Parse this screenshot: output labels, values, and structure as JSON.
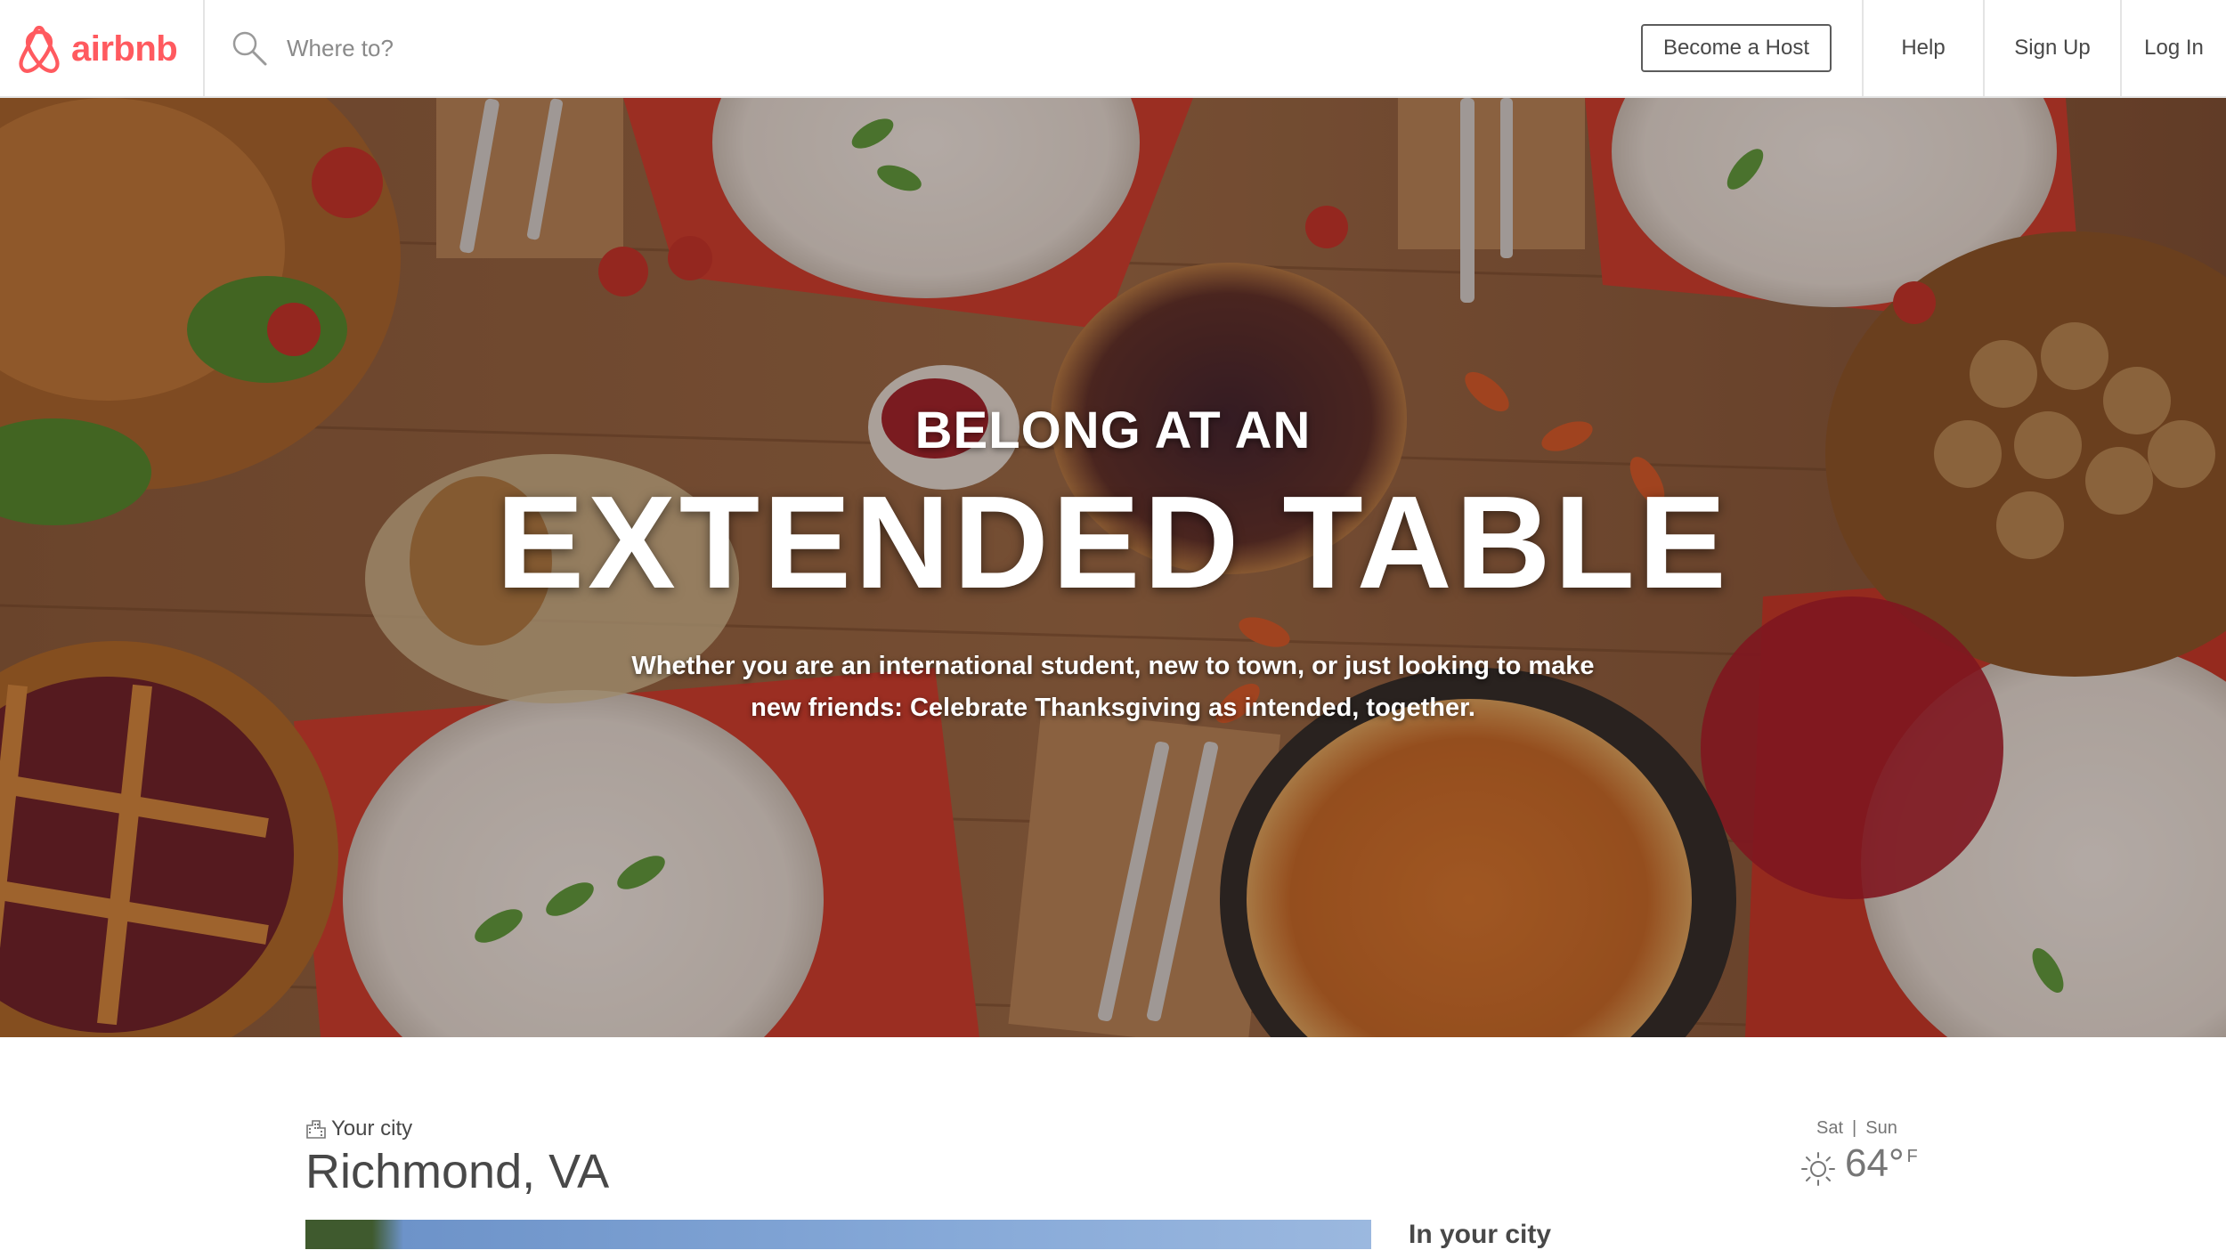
{
  "brand": {
    "name": "airbnb",
    "color": "#ff5a5f",
    "icon": "airbnb-belo-icon"
  },
  "search": {
    "placeholder": "Where to?",
    "icon": "search-icon"
  },
  "nav": {
    "become_host": "Become a Host",
    "help": "Help",
    "sign_up": "Sign Up",
    "log_in": "Log In"
  },
  "hero": {
    "kicker": "BELONG AT AN",
    "title": "EXTENDED TABLE",
    "subtitle_line1": "Whether you are an international student, new to town, or just looking to make",
    "subtitle_line2": "new friends: Celebrate Thanksgiving as intended, together."
  },
  "city": {
    "label": "Your city",
    "label_icon": "city-building-icon",
    "name": "Richmond, VA",
    "section_title": "In your city"
  },
  "weather": {
    "day1": "Sat",
    "separator": "|",
    "day2": "Sun",
    "temperature": "64°",
    "unit": "F",
    "icon": "sun-icon"
  },
  "colors": {
    "accent": "#ff5a5f",
    "text": "#484848",
    "muted": "#767676"
  }
}
